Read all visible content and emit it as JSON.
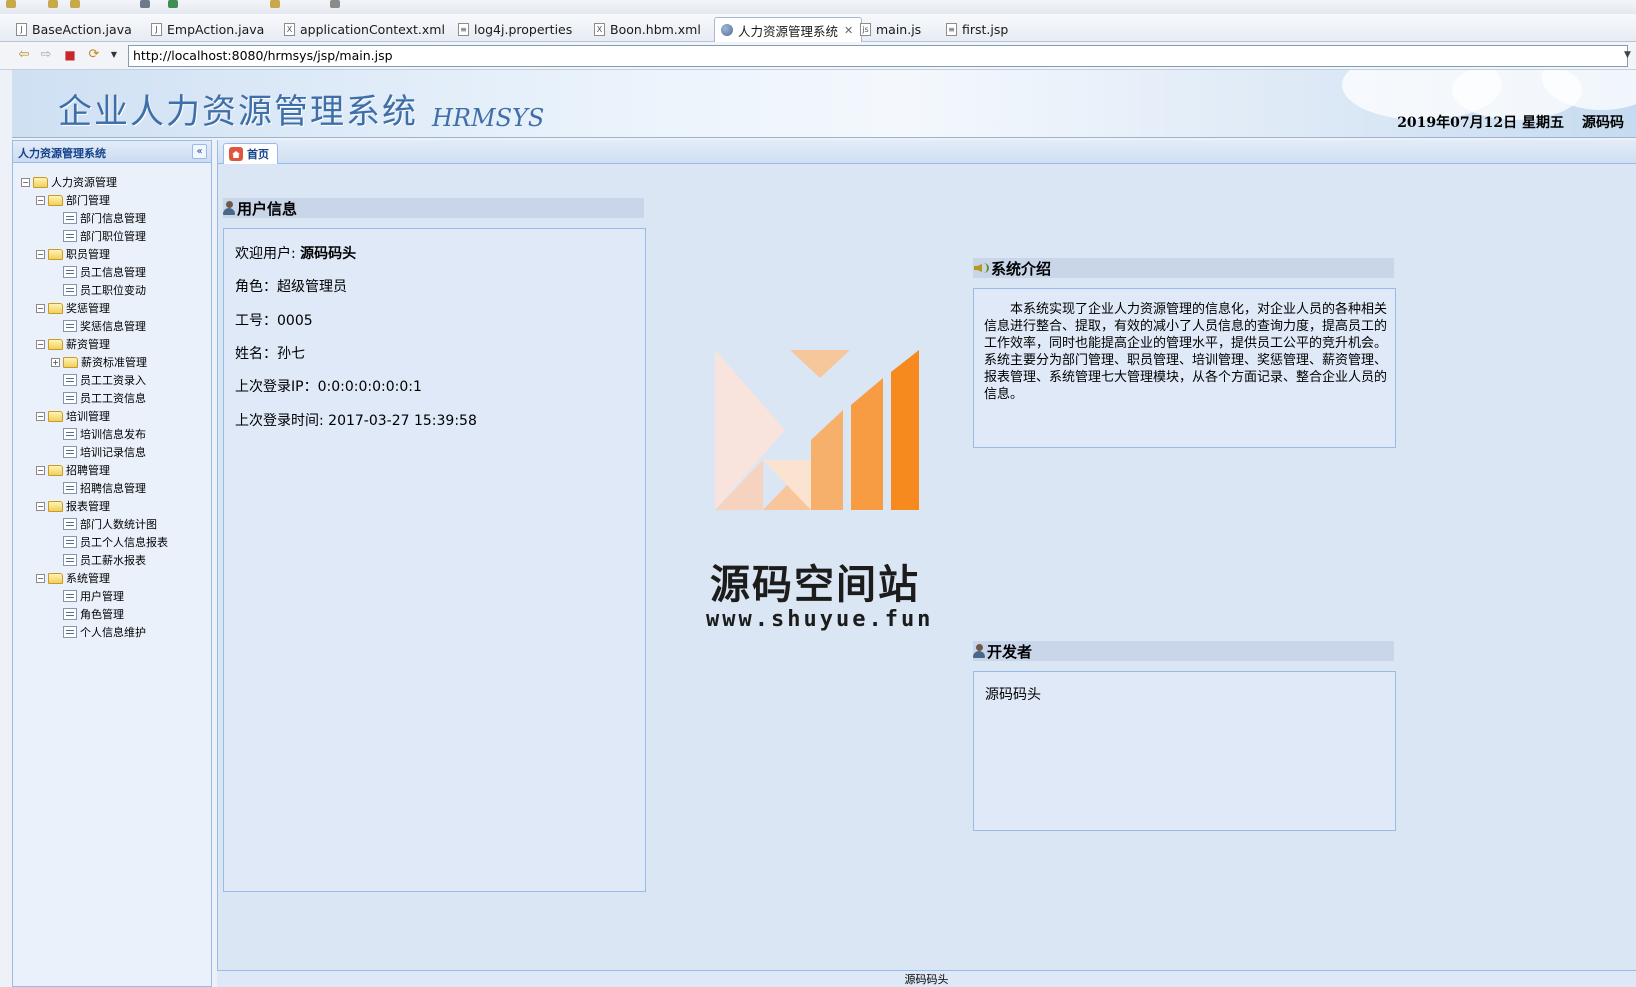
{
  "editor_tabs": [
    {
      "label": "BaseAction.java",
      "type": "J"
    },
    {
      "label": "EmpAction.java",
      "type": "J"
    },
    {
      "label": "applicationContext.xml",
      "type": "X"
    },
    {
      "label": "log4j.properties",
      "type": "≡"
    },
    {
      "label": "Boon.hbm.xml",
      "type": "X"
    },
    {
      "label": "人力资源管理系统",
      "type": "globe",
      "active": true
    },
    {
      "label": "main.js",
      "type": "js"
    },
    {
      "label": "first.jsp",
      "type": "≡"
    }
  ],
  "browser": {
    "url": "http://localhost:8080/hrmsys/jsp/main.jsp"
  },
  "header": {
    "title": "企业人力资源管理系统",
    "subtitle": "HRMSYS",
    "date": "2019年07月12日 星期五",
    "user": "源码码"
  },
  "sidebar": {
    "title": "人力资源管理系统",
    "collapse_glyph": "«",
    "tree": [
      {
        "label": "人力资源管理",
        "level": 0,
        "kind": "folder",
        "toggle": "−"
      },
      {
        "label": "部门管理",
        "level": 1,
        "kind": "folder",
        "toggle": "−"
      },
      {
        "label": "部门信息管理",
        "level": 2,
        "kind": "leaf"
      },
      {
        "label": "部门职位管理",
        "level": 2,
        "kind": "leaf"
      },
      {
        "label": "职员管理",
        "level": 1,
        "kind": "folder",
        "toggle": "−"
      },
      {
        "label": "员工信息管理",
        "level": 2,
        "kind": "leaf"
      },
      {
        "label": "员工职位变动",
        "level": 2,
        "kind": "leaf"
      },
      {
        "label": "奖惩管理",
        "level": 1,
        "kind": "folder",
        "toggle": "−"
      },
      {
        "label": "奖惩信息管理",
        "level": 2,
        "kind": "leaf"
      },
      {
        "label": "薪资管理",
        "level": 1,
        "kind": "folder",
        "toggle": "−"
      },
      {
        "label": "薪资标准管理",
        "level": 2,
        "kind": "folder",
        "toggle": "+"
      },
      {
        "label": "员工工资录入",
        "level": 2,
        "kind": "leaf"
      },
      {
        "label": "员工工资信息",
        "level": 2,
        "kind": "leaf"
      },
      {
        "label": "培训管理",
        "level": 1,
        "kind": "folder",
        "toggle": "−"
      },
      {
        "label": "培训信息发布",
        "level": 2,
        "kind": "leaf"
      },
      {
        "label": "培训记录信息",
        "level": 2,
        "kind": "leaf"
      },
      {
        "label": "招聘管理",
        "level": 1,
        "kind": "folder",
        "toggle": "−"
      },
      {
        "label": "招聘信息管理",
        "level": 2,
        "kind": "leaf"
      },
      {
        "label": "报表管理",
        "level": 1,
        "kind": "folder",
        "toggle": "−"
      },
      {
        "label": "部门人数统计图",
        "level": 2,
        "kind": "leaf"
      },
      {
        "label": "员工个人信息报表",
        "level": 2,
        "kind": "leaf"
      },
      {
        "label": "员工薪水报表",
        "level": 2,
        "kind": "leaf"
      },
      {
        "label": "系统管理",
        "level": 1,
        "kind": "folder",
        "toggle": "−"
      },
      {
        "label": "用户管理",
        "level": 2,
        "kind": "leaf"
      },
      {
        "label": "角色管理",
        "level": 2,
        "kind": "leaf"
      },
      {
        "label": "个人信息维护",
        "level": 2,
        "kind": "leaf"
      }
    ]
  },
  "main": {
    "tab_label": "首页",
    "user_info": {
      "title": "用户信息",
      "welcome_label": "欢迎用户: ",
      "welcome_name": "源码码头",
      "role": "角色：超级管理员",
      "emp_no": "工号：0005",
      "name": "姓名：孙七",
      "last_ip": "上次登录IP：0:0:0:0:0:0:0:1",
      "last_time": "上次登录时间: 2017-03-27 15:39:58"
    },
    "intro": {
      "title": "系统介绍",
      "text": "本系统实现了企业人力资源管理的信息化，对企业人员的各种相关信息进行整合、提取，有效的减小了人员信息的查询力度，提高员工的工作效率，同时也能提高企业的管理水平，提供员工公平的竞升机会。系统主要分为部门管理、职员管理、培训管理、奖惩管理、薪资管理、报表管理、系统管理七大管理模块，从各个方面记录、整合企业人员的信息。"
    },
    "developer": {
      "title": "开发者",
      "text": "源码码头"
    }
  },
  "watermark": {
    "title": "源码空间站",
    "url": "www.shuyue.fun"
  },
  "footer": {
    "text": "源码码头"
  },
  "colors": {
    "ext_border": "#99bbe8",
    "ext_text": "#15428b",
    "logo_orange": "#f68a1e"
  }
}
